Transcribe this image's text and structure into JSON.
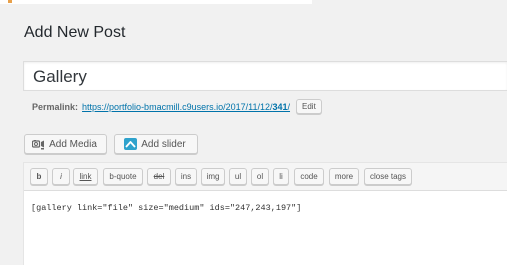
{
  "page_title": "Add New Post",
  "post_title": {
    "value": "Gallery"
  },
  "permalink": {
    "label": "Permalink:",
    "url_prefix": "https://portfolio-bmacmill.c9users.io/2017/11/12/",
    "url_slug": "341",
    "url_suffix": "/",
    "edit_label": "Edit"
  },
  "media_buttons": {
    "add_media": "Add Media",
    "add_slider": "Add slider",
    "add_media_icon": "media-camera-icon",
    "add_slider_icon": "slider-image-icon"
  },
  "quicktags": {
    "b": "b",
    "i": "i",
    "link": "link",
    "bquote": "b-quote",
    "del": "del",
    "ins": "ins",
    "img": "img",
    "ul": "ul",
    "ol": "ol",
    "li": "li",
    "code": "code",
    "more": "more",
    "close_tags": "close tags"
  },
  "editor": {
    "content": "[gallery link=\"file\" size=\"medium\" ids=\"247,243,197\"]"
  },
  "colors": {
    "link": "#0073aa",
    "background": "#f1f1f1",
    "slider_icon": "#2ea2cc"
  }
}
